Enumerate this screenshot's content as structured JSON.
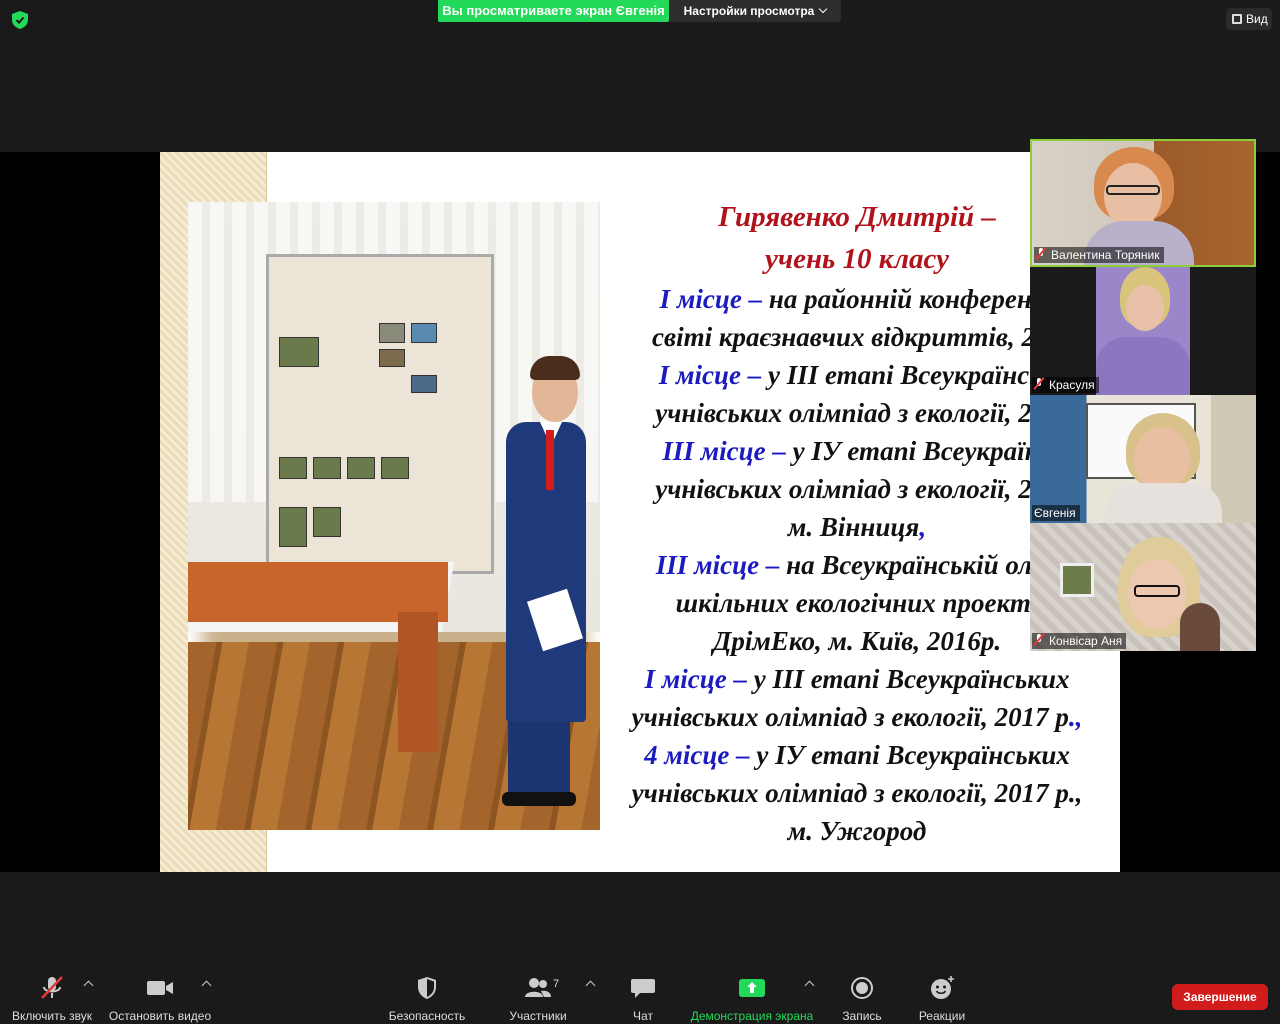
{
  "top_bar": {
    "viewing_banner": "Вы просматриваете экран Євгенія",
    "view_options_label": "Настройки просмотра",
    "view_button_label": "Вид"
  },
  "slide": {
    "name_line1": "Гирявенко Дмитрій  –",
    "name_line2": "учень 10 класу",
    "lines": [
      {
        "hl": "І місце –",
        "text": " на районній конференці"
      },
      {
        "hl": "",
        "text": "світі краєзнавчих відкриттів, 201"
      },
      {
        "hl": "І місце –",
        "text": " у ІІІ етапі Всеукраїнськ"
      },
      {
        "hl": "",
        "text": "учнівських олімпіад з екології, 201"
      },
      {
        "hl": "ІІІ місце –",
        "text": " у ІУ етапі Всеукраїнс"
      },
      {
        "hl": "",
        "text": "учнівських олімпіад з екології, 201"
      },
      {
        "hl": "",
        "text": "м. Вінниця",
        "hl_after": ","
      },
      {
        "hl": "ІІІ місце –",
        "text": " на Всеукраїнській олім"
      },
      {
        "hl": "",
        "text": "шкільних екологічних проекті"
      },
      {
        "hl": "",
        "text": "ДрімЕко, м. Київ, 2016р."
      },
      {
        "hl": "І місце –",
        "text": " у ІІІ етапі Всеукраїнських"
      },
      {
        "hl": "",
        "text": "учнівських олімпіад з екології, 2017 р",
        "hl_after": ".,"
      },
      {
        "hl": "4 місце –",
        "text": " у ІУ етапі Всеукраїнських"
      },
      {
        "hl": "",
        "text": "учнівських олімпіад з екології, 2017 р.,"
      },
      {
        "hl": "",
        "text": "м. Ужгород"
      }
    ]
  },
  "participants": [
    {
      "name": "Валентина Торяник",
      "muted": true,
      "active": true
    },
    {
      "name": "Красуля",
      "muted": true,
      "active": false
    },
    {
      "name": "Євгенія",
      "muted": false,
      "active": false
    },
    {
      "name": "Конвісар Аня",
      "muted": true,
      "active": false
    }
  ],
  "toolbar": {
    "unmute": "Включить звук",
    "start_video": "Остановить видео",
    "security": "Безопасность",
    "participants": "Участники",
    "participants_count": "7",
    "chat": "Чат",
    "share_screen": "Демонстрация экрана",
    "record": "Запись",
    "reactions": "Реакции",
    "end": "Завершение"
  },
  "colors": {
    "green_accent": "#23d959",
    "end_red": "#d21c1c",
    "slide_name_red": "#b0131b",
    "slide_highlight_blue": "#1b1bbf"
  }
}
